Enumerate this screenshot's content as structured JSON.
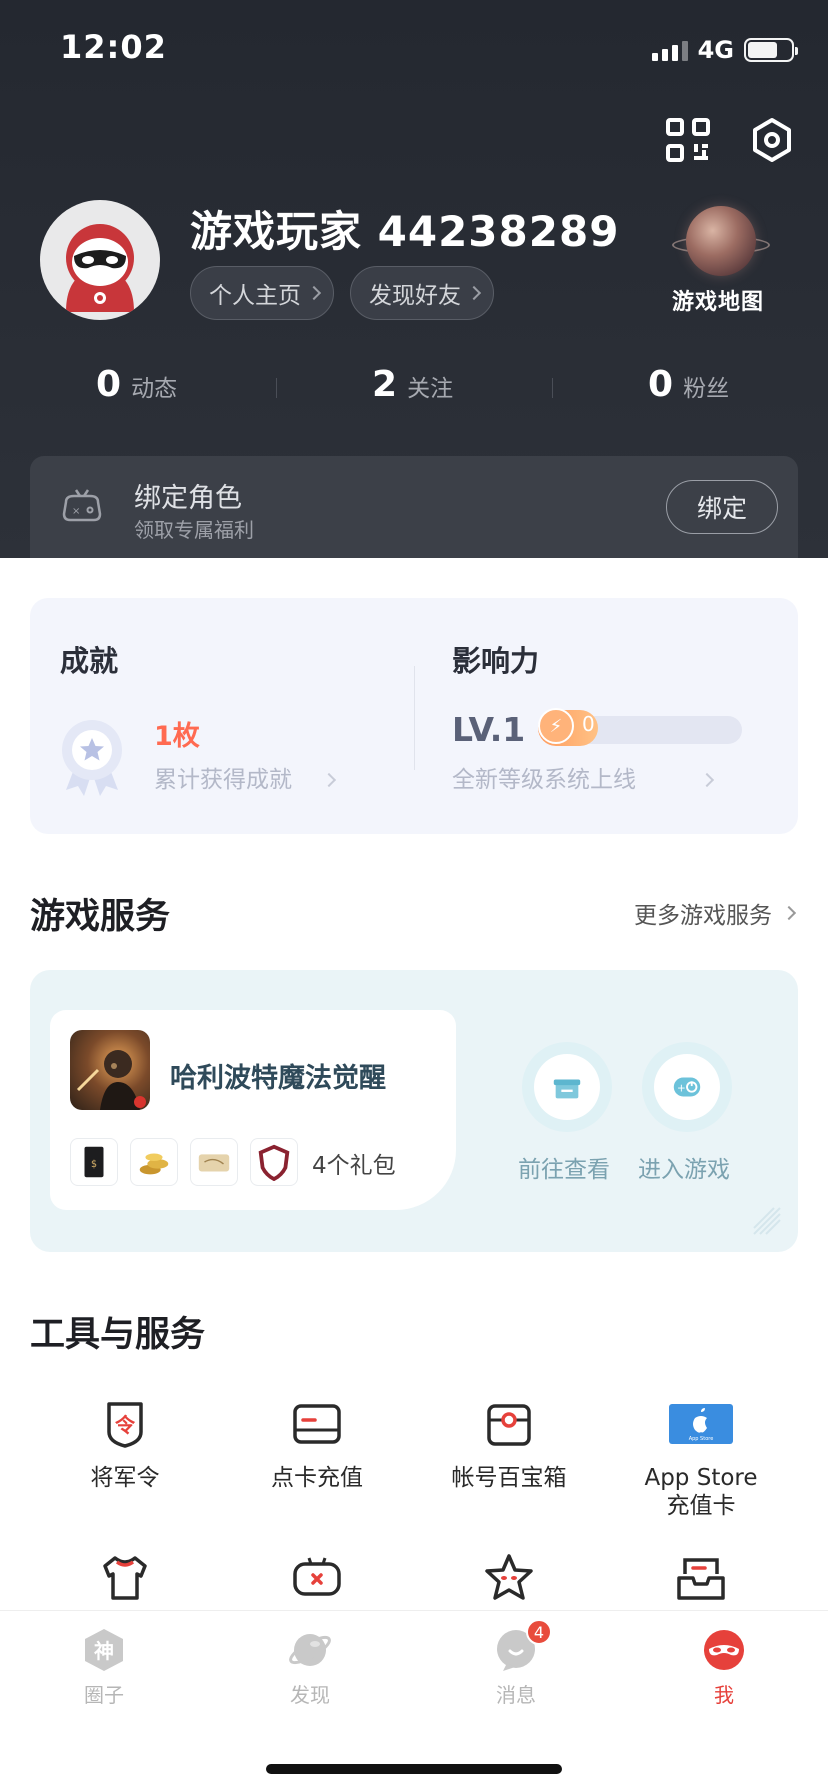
{
  "status_bar": {
    "time": "12:02",
    "network": "4G"
  },
  "profile": {
    "username": "游戏玩家 44238289",
    "homepage_button": "个人主页",
    "find_friends_button": "发现好友",
    "game_map_label": "游戏地图"
  },
  "stats": [
    {
      "value": "0",
      "label": "动态"
    },
    {
      "value": "2",
      "label": "关注"
    },
    {
      "value": "0",
      "label": "粉丝"
    }
  ],
  "bind_role": {
    "title": "绑定角色",
    "subtitle": "领取专属福利",
    "button": "绑定"
  },
  "achievements": {
    "title": "成就",
    "count": "1枚",
    "desc": "累计获得成就",
    "influence_title": "影响力",
    "level": "LV.1",
    "level_points": "0",
    "level_desc": "全新等级系统上线"
  },
  "game_services": {
    "title": "游戏服务",
    "more": "更多游戏服务",
    "game_name": "哈利波特魔法觉醒",
    "gift_count": "4个礼包",
    "view_button": "前往查看",
    "enter_button": "进入游戏"
  },
  "tools": {
    "title": "工具与服务",
    "items": [
      {
        "label": "将军令",
        "icon": "token-shield-icon"
      },
      {
        "label": "点卡充值",
        "icon": "card-icon"
      },
      {
        "label": "帐号百宝箱",
        "icon": "treasure-box-icon"
      },
      {
        "label": "App Store\n充值卡",
        "icon": "app-store-card-icon"
      },
      {
        "label": "",
        "icon": "tshirt-icon"
      },
      {
        "label": "",
        "icon": "gamepad-icon"
      },
      {
        "label": "",
        "icon": "star-face-icon"
      },
      {
        "label": "",
        "icon": "inbox-icon"
      }
    ]
  },
  "tabs": [
    {
      "label": "圈子",
      "icon": "shen-icon"
    },
    {
      "label": "发现",
      "icon": "planet-icon"
    },
    {
      "label": "消息",
      "icon": "message-icon",
      "badge": "4"
    },
    {
      "label": "我",
      "icon": "mask-icon",
      "active": true
    }
  ],
  "colors": {
    "accent": "#e6413b",
    "header_bg": "#272b33",
    "level_orange": "#ff9b5e"
  }
}
